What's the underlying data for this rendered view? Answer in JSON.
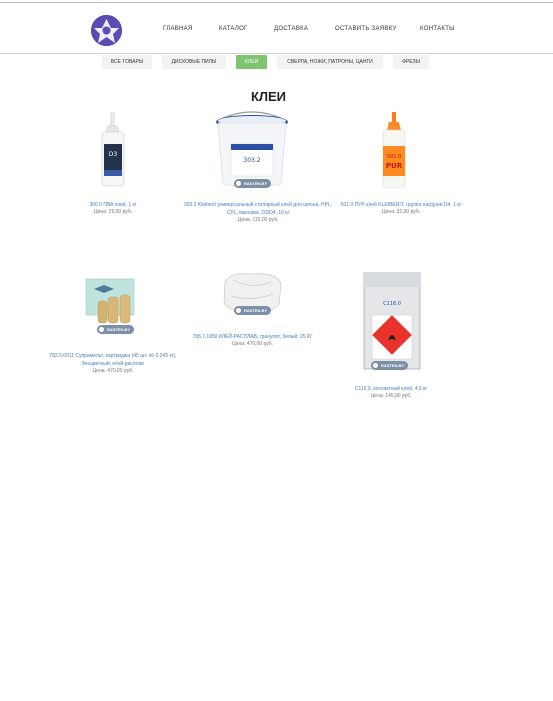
{
  "nav": {
    "items": [
      "ГЛАВНАЯ",
      "КАТАЛОГ",
      "ДОСТАВКА",
      "ОСТАВИТЬ ЗАЯВКУ",
      "КОНТАКТЫ"
    ]
  },
  "categories": {
    "items": [
      "ВСЕ ТОВАРЫ",
      "ДИСКОВЫЕ ПИЛЫ",
      "КЛЕИ",
      "СВЕРЛА, НОЖИ, ПАТРОНЫ, ЦАНГИ",
      "ФРЕЗЫ"
    ],
    "active": "КЛЕИ"
  },
  "page": {
    "title": "КЛЕИ"
  },
  "badge_text": "RASTEN.BY",
  "products": [
    {
      "name": "300.0 ПВА клей, 1 кг",
      "price": "Цена: 25,00 руб.",
      "icon": "white-glue-bottle"
    },
    {
      "name": "303.2 Kleiberit универсальный столярный клей для шпона, HPL, CPL, массива, D3/D4, 10 кг",
      "price": "Цена: 110,00 руб.",
      "icon": "glue-bucket"
    },
    {
      "name": "501.0 ПУР клей KLEIBERIT, группа нагрузки D4, 1 кг",
      "price": "Цена: 32,00 руб.",
      "icon": "pur-glue-bottle"
    },
    {
      "name": "782.5.0011 Супрамельт, картриджи (45 шт. по 0,245 кг), бесцветный, клей-расплав",
      "price": "Цена: 470,00 руб.",
      "icon": "cartridge-box"
    },
    {
      "name": "788.7.1050 КЛЕЙ-РАСПЛАВ, гранулят, белый, 25 КГ",
      "price": "Цена: 470,00 руб.",
      "icon": "granulate-bag"
    },
    {
      "name": "С116.0, контактный клей, 4,5 кг",
      "price": "Цена: 145,00 руб.",
      "icon": "contact-glue-canister"
    }
  ]
}
